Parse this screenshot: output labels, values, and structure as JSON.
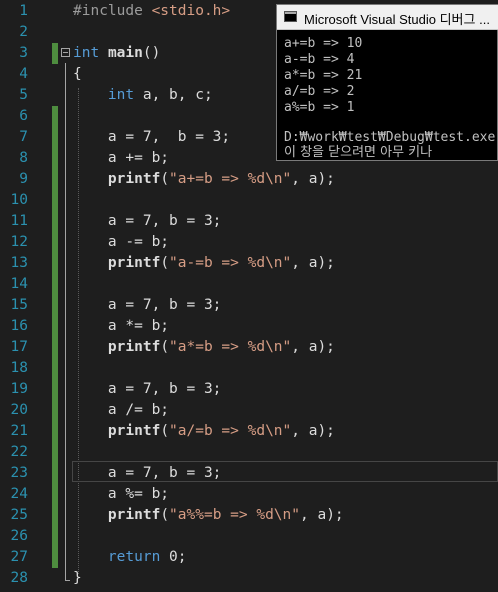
{
  "editor": {
    "lines": [
      {
        "num": "1",
        "tokens": [
          {
            "t": "#include ",
            "c": "pp"
          },
          {
            "t": "<stdio.h>",
            "c": "inc"
          }
        ]
      },
      {
        "num": "2",
        "tokens": []
      },
      {
        "num": "3",
        "tokens": [
          {
            "t": "int",
            "c": "kw"
          },
          {
            "t": " ",
            "c": ""
          },
          {
            "t": "main",
            "c": "fn"
          },
          {
            "t": "()",
            "c": ""
          }
        ]
      },
      {
        "num": "4",
        "tokens": [
          {
            "t": "{",
            "c": ""
          }
        ]
      },
      {
        "num": "5",
        "tokens": [
          {
            "t": "    ",
            "c": ""
          },
          {
            "t": "int",
            "c": "kw"
          },
          {
            "t": " a, b, c;",
            "c": ""
          }
        ]
      },
      {
        "num": "6",
        "tokens": []
      },
      {
        "num": "7",
        "tokens": [
          {
            "t": "    a = 7,  b = 3;",
            "c": ""
          }
        ]
      },
      {
        "num": "8",
        "tokens": [
          {
            "t": "    a += b;",
            "c": ""
          }
        ]
      },
      {
        "num": "9",
        "tokens": [
          {
            "t": "    ",
            "c": ""
          },
          {
            "t": "printf",
            "c": "fn"
          },
          {
            "t": "(",
            "c": ""
          },
          {
            "t": "\"a+=b => %d\\n\"",
            "c": "str"
          },
          {
            "t": ", a);",
            "c": ""
          }
        ]
      },
      {
        "num": "10",
        "tokens": []
      },
      {
        "num": "11",
        "tokens": [
          {
            "t": "    a = 7, b = 3;",
            "c": ""
          }
        ]
      },
      {
        "num": "12",
        "tokens": [
          {
            "t": "    a -= b;",
            "c": ""
          }
        ]
      },
      {
        "num": "13",
        "tokens": [
          {
            "t": "    ",
            "c": ""
          },
          {
            "t": "printf",
            "c": "fn"
          },
          {
            "t": "(",
            "c": ""
          },
          {
            "t": "\"a-=b => %d\\n\"",
            "c": "str"
          },
          {
            "t": ", a);",
            "c": ""
          }
        ]
      },
      {
        "num": "14",
        "tokens": []
      },
      {
        "num": "15",
        "tokens": [
          {
            "t": "    a = 7, b = 3;",
            "c": ""
          }
        ]
      },
      {
        "num": "16",
        "tokens": [
          {
            "t": "    a *= b;",
            "c": ""
          }
        ]
      },
      {
        "num": "17",
        "tokens": [
          {
            "t": "    ",
            "c": ""
          },
          {
            "t": "printf",
            "c": "fn"
          },
          {
            "t": "(",
            "c": ""
          },
          {
            "t": "\"a*=b => %d\\n\"",
            "c": "str"
          },
          {
            "t": ", a);",
            "c": ""
          }
        ]
      },
      {
        "num": "18",
        "tokens": []
      },
      {
        "num": "19",
        "tokens": [
          {
            "t": "    a = 7, b = 3;",
            "c": ""
          }
        ]
      },
      {
        "num": "20",
        "tokens": [
          {
            "t": "    a /= b;",
            "c": ""
          }
        ]
      },
      {
        "num": "21",
        "tokens": [
          {
            "t": "    ",
            "c": ""
          },
          {
            "t": "printf",
            "c": "fn"
          },
          {
            "t": "(",
            "c": ""
          },
          {
            "t": "\"a/=b => %d\\n\"",
            "c": "str"
          },
          {
            "t": ", a);",
            "c": ""
          }
        ]
      },
      {
        "num": "22",
        "tokens": []
      },
      {
        "num": "23",
        "tokens": [
          {
            "t": "    a = 7, b = 3;",
            "c": ""
          }
        ]
      },
      {
        "num": "24",
        "tokens": [
          {
            "t": "    a %= b;",
            "c": ""
          }
        ]
      },
      {
        "num": "25",
        "tokens": [
          {
            "t": "    ",
            "c": ""
          },
          {
            "t": "printf",
            "c": "fn"
          },
          {
            "t": "(",
            "c": ""
          },
          {
            "t": "\"a%%=b => %d\\n\"",
            "c": "str"
          },
          {
            "t": ", a);",
            "c": ""
          }
        ]
      },
      {
        "num": "26",
        "tokens": []
      },
      {
        "num": "27",
        "tokens": [
          {
            "t": "    ",
            "c": ""
          },
          {
            "t": "return",
            "c": "kw"
          },
          {
            "t": " 0;",
            "c": ""
          }
        ]
      },
      {
        "num": "28",
        "tokens": [
          {
            "t": "}",
            "c": ""
          }
        ]
      }
    ]
  },
  "console": {
    "title": "Microsoft Visual Studio 디버그 ...",
    "output": [
      "a+=b => 10",
      "a-=b => 4",
      "a*=b => 21",
      "a/=b => 2",
      "a%=b => 1"
    ],
    "path": "D:₩work₩test₩Debug₩test.exe",
    "close_message": "이 창을 닫으려면 아무 키나"
  }
}
